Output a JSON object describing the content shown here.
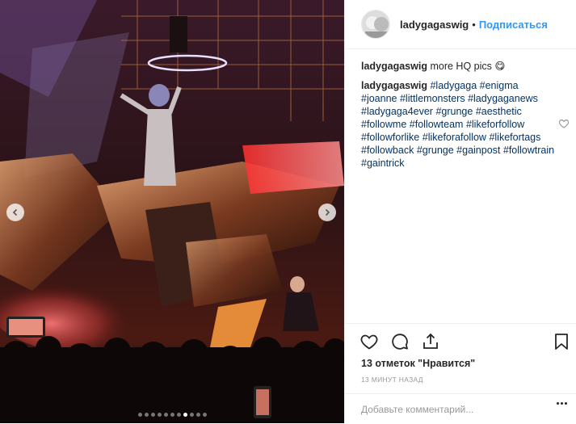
{
  "header": {
    "username": "ladygagaswig",
    "separator": "•",
    "follow_label": "Подписаться"
  },
  "caption": {
    "username": "ladygagaswig",
    "text": "more HQ pics 😋"
  },
  "hashtag_comment": {
    "username": "ladygagaswig",
    "tags": [
      "#ladygaga",
      "#enigma",
      "#joanne",
      "#littlemonsters",
      "#ladygaganews",
      "#ladygaga4ever",
      "#grunge",
      "#aesthetic",
      "#followme",
      "#followteam",
      "#likeforfollow",
      "#followforlike",
      "#likeforafollow",
      "#likefortags",
      "#followback",
      "#grunge",
      "#gainpost",
      "#followtrain",
      "#gaintrick"
    ]
  },
  "likes": "13 отметок \"Нравится\"",
  "timestamp": "13 МИНУТ НАЗАД",
  "add_comment": {
    "placeholder": "Добавьте комментарий..."
  },
  "carousel": {
    "slides": 11,
    "active": 8
  },
  "icons": {
    "like": "heart-icon",
    "comment": "comment-icon",
    "share": "share-icon",
    "save": "bookmark-icon",
    "prev": "chevron-left-icon",
    "next": "chevron-right-icon"
  },
  "colors": {
    "link": "#3897f0",
    "hashtag": "#003569",
    "text": "#262626",
    "muted": "#999999"
  }
}
